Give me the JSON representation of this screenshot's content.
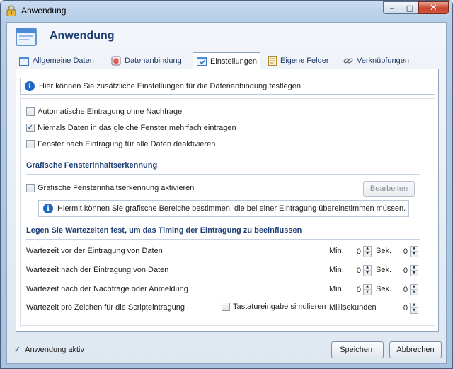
{
  "window": {
    "title": "Anwendung",
    "controls": {
      "minimize": "‒",
      "maximize": "□",
      "close": "✕"
    }
  },
  "header": {
    "title": "Anwendung"
  },
  "tabs": [
    {
      "label": "Allgemeine Daten",
      "icon": "window-icon",
      "active": false
    },
    {
      "label": "Datenanbindung",
      "icon": "database-icon",
      "active": false
    },
    {
      "label": "Einstellungen",
      "icon": "settings-window-icon",
      "active": true
    },
    {
      "label": "Eigene Felder",
      "icon": "document-icon",
      "active": false
    },
    {
      "label": "Verknüpfungen",
      "icon": "link-icon",
      "active": false
    }
  ],
  "info": {
    "text": "Hier können Sie zusätzliche Einstellungen für die Datenanbindung festlegen."
  },
  "options": [
    {
      "label": "Automatische Eintragung ohne Nachfrage",
      "checked": false
    },
    {
      "label": "Niemals Daten in das gleiche Fenster mehrfach eintragen",
      "checked": true
    },
    {
      "label": "Fenster nach Eintragung für alle Daten deaktivieren",
      "checked": false
    }
  ],
  "graphic": {
    "section_title": "Grafische Fensterinhaltserkennung",
    "checkbox_label": "Grafische Fensterinhaltserkennung aktivieren",
    "checked": false,
    "edit_button": "Bearbeiten",
    "hint": "Hiermit können Sie grafische Bereiche bestimmen, die bei einer Eintragung übereinstimmen müssen."
  },
  "timing": {
    "section_title": "Legen Sie Wartezeiten fest, um das Timing der Eintragung zu beeinflussen",
    "min_label": "Min.",
    "sec_label": "Sek.",
    "rows": [
      {
        "label": "Wartezeit vor der Eintragung von Daten",
        "min": "0",
        "sec": "0"
      },
      {
        "label": "Wartezeit nach der Eintragung von Daten",
        "min": "0",
        "sec": "0"
      },
      {
        "label": "Wartezeit nach der Nachfrage oder Anmeldung",
        "min": "0",
        "sec": "0"
      }
    ],
    "per_char": {
      "label": "Wartezeit pro Zeichen für die Scripteintragung",
      "simulate_label": "Tastatureingabe simulieren",
      "simulate_checked": false,
      "unit": "Millisekunden",
      "value": "0"
    }
  },
  "footer": {
    "active_label": "Anwendung aktiv",
    "active_checked": true,
    "save_button": "Speichern",
    "cancel_button": "Abbrechen"
  },
  "colors": {
    "accent": "#1d3f75",
    "info_icon": "#1f67c7",
    "close_button": "#c7442c"
  }
}
